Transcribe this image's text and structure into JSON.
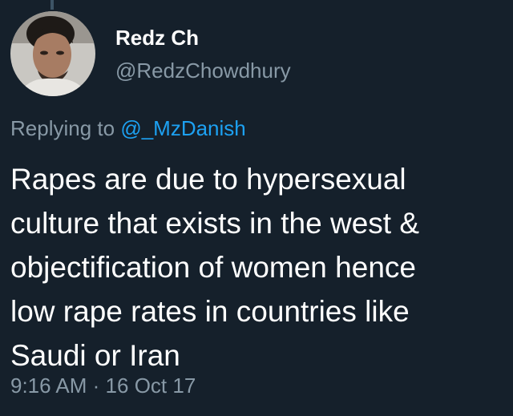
{
  "tweet": {
    "author": {
      "display_name": "Redz Ch",
      "handle": "@RedzChowdhury"
    },
    "reply_to": {
      "prefix": "Replying to",
      "handle": "@_MzDanish"
    },
    "text_lines": [
      "Rapes are due to hypersexual",
      "culture that exists in the west &",
      "objectification of women hence",
      "low rape rates in countries like",
      "Saudi or Iran"
    ],
    "time": "9:16 AM",
    "separator": "·",
    "date": "16 Oct 17"
  },
  "colors": {
    "background": "#15202b",
    "primary_text": "#ffffff",
    "secondary_text": "#8899a6",
    "link": "#1da1f2"
  }
}
